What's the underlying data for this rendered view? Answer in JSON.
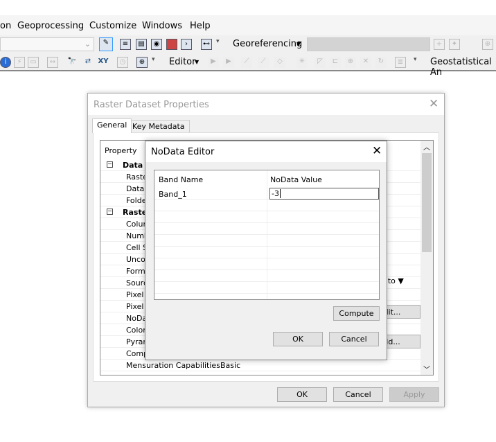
{
  "menu": [
    "on",
    "Geoprocessing",
    "Customize",
    "Windows",
    "Help"
  ],
  "toolbar": {
    "georeferencing": "Georeferencing",
    "editor": "Editor",
    "geostatistical": "Geostatistical An"
  },
  "dialog": {
    "title": "Raster Dataset Properties",
    "tabs": [
      "General",
      "Key Metadata"
    ],
    "grid_header": "Property",
    "rows": [
      "Data S",
      "Raste",
      "Data T",
      "Folder",
      "Raste",
      "Colum",
      "Numb",
      "Cell Si",
      "Uncon",
      "Forma",
      "Sourc",
      "Pixel T",
      "Pixel D",
      "NoDat",
      "Colorr",
      "Pyram",
      "Comp",
      "Mensuration Capabilities"
    ],
    "mensuration_value": "Basic",
    "behind_texts": [
      "tch to",
      "dit...",
      "ild..."
    ],
    "ok": "OK",
    "cancel": "Cancel",
    "apply": "Apply"
  },
  "editor": {
    "title": "NoData Editor",
    "columns": [
      "Band Name",
      "NoData Value"
    ],
    "band": "Band_1",
    "value": "-3",
    "compute": "Compute",
    "ok": "OK",
    "cancel": "Cancel"
  }
}
